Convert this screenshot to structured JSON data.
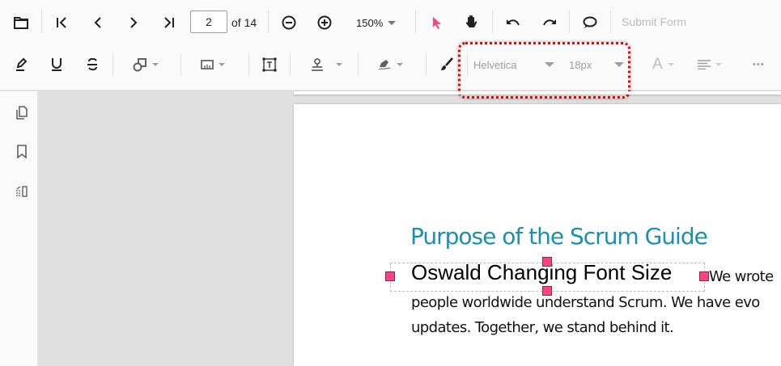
{
  "toolbar": {
    "page_number": "2",
    "page_count_label": "of 14",
    "zoom_value": "150%",
    "submit_form_label": "Submit Form",
    "font_family": "Helvetica",
    "font_size": "18px",
    "font_color_glyph": "A",
    "more_glyph": "•••",
    "accent_color": "#ff4081",
    "highlight_outline_color": "#ee0000"
  },
  "document": {
    "heading": "Purpose of the Scrum Guide",
    "free_text_annotation": "Oswald Changing Font Size",
    "line1_tail": "We wrote",
    "line2": "people worldwide understand Scrum.  We have evo",
    "line3": "updates. Together, we stand behind it."
  },
  "sidebar": {
    "items": [
      "page-thumbnails",
      "bookmarks",
      "organize-pages"
    ]
  }
}
